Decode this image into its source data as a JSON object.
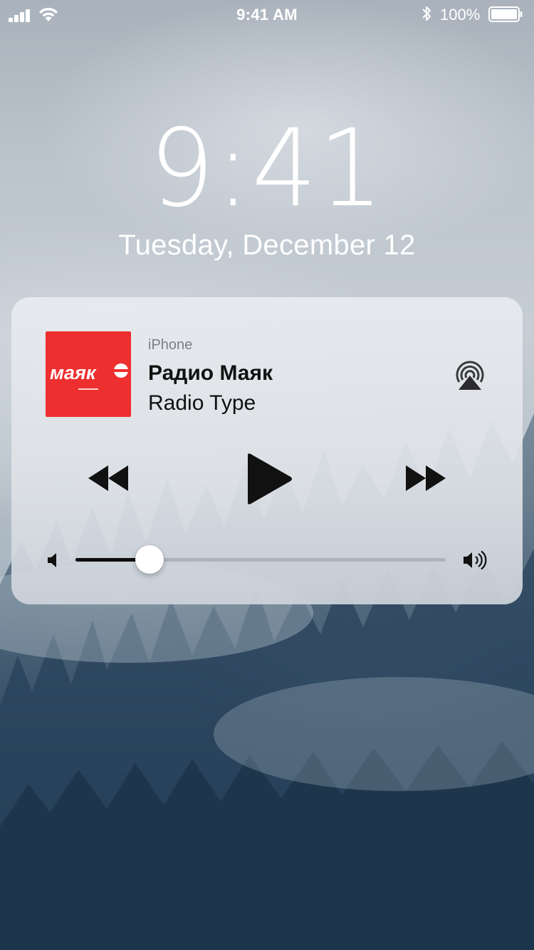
{
  "status_bar": {
    "time": "9:41 AM",
    "battery": "100%",
    "signal_bars": 4,
    "battery_level": 1.0
  },
  "lock_screen": {
    "time": "9:41",
    "date": "Tuesday, December 12"
  },
  "now_playing": {
    "source": "iPhone",
    "title": "Радио Маяк",
    "subtitle": "Radio Type",
    "artwork_color": "#ee2f2f",
    "volume": 0.2,
    "icons": [
      "airplay-icon",
      "rewind-icon",
      "play-icon",
      "fast-forward-icon",
      "volume-low-icon",
      "volume-high-icon"
    ]
  }
}
